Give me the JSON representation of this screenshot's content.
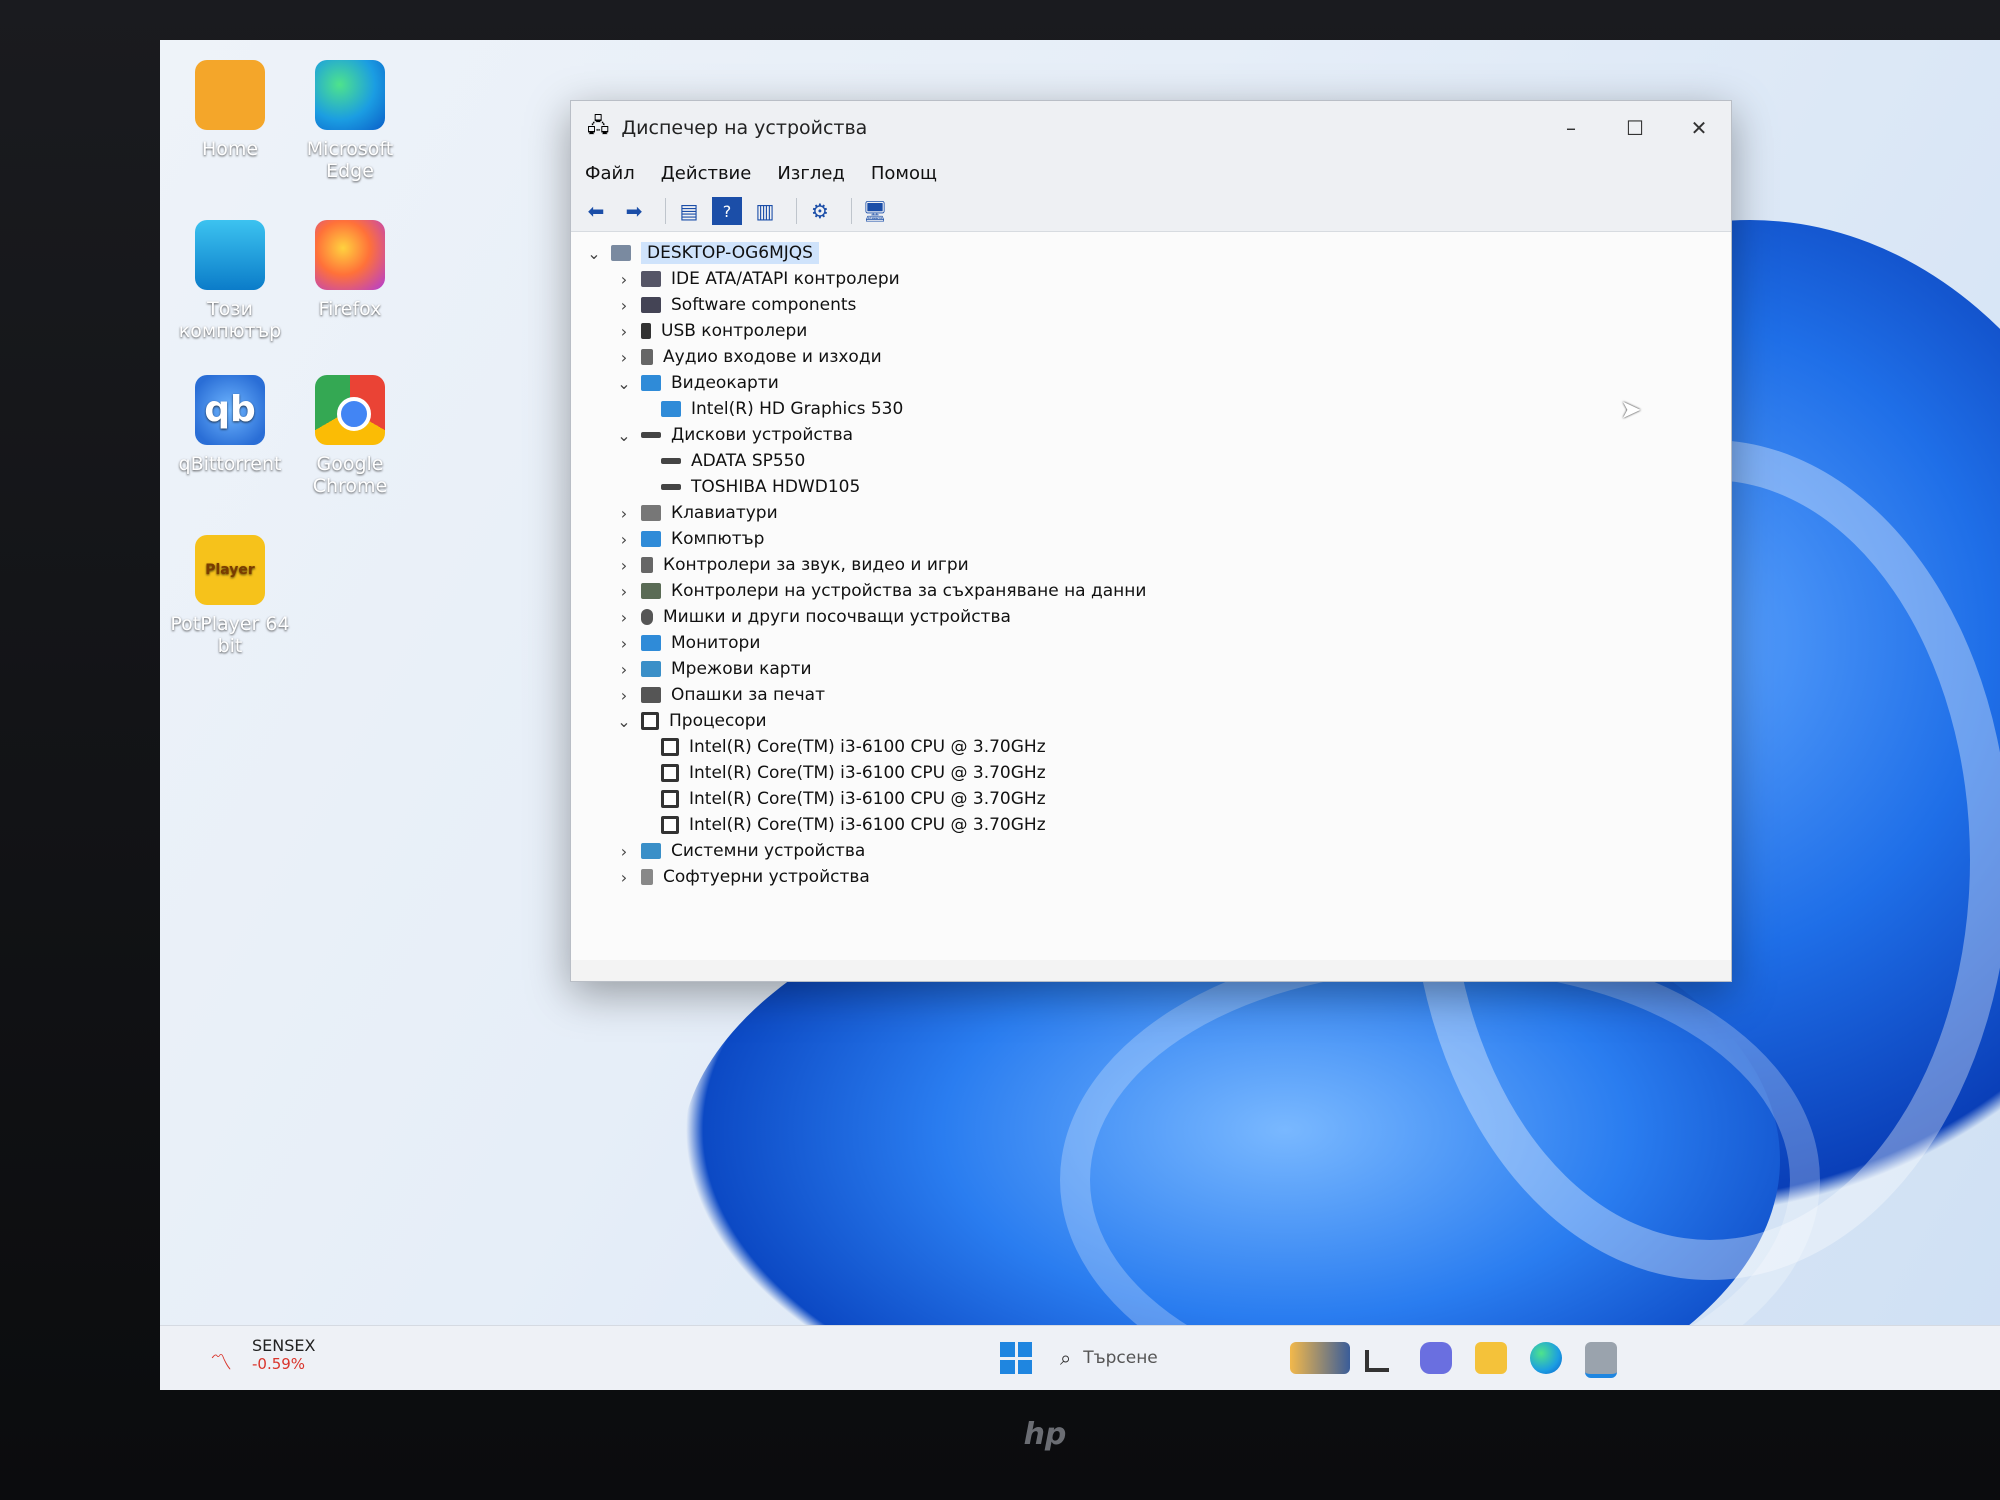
{
  "desktop": {
    "icons": [
      {
        "label": "Home"
      },
      {
        "label": "Microsoft Edge"
      },
      {
        "label": "Този компютър"
      },
      {
        "label": "Firefox"
      },
      {
        "label": "qBittorrent"
      },
      {
        "label": "Google Chrome"
      },
      {
        "label": "PotPlayer 64 bit"
      }
    ]
  },
  "window": {
    "title": "Диспечер на устройства",
    "controls": {
      "minimize": "–",
      "maximize": "☐",
      "close": "✕"
    },
    "menu": [
      "Файл",
      "Действие",
      "Изглед",
      "Помощ"
    ],
    "toolbar_icons": [
      "back-icon",
      "forward-icon",
      "properties-icon",
      "help-icon",
      "view-icon",
      "scan-icon",
      "monitor-icon"
    ],
    "tree": {
      "root": "DESKTOP-OG6MJQS",
      "nodes": [
        {
          "label": "IDE ATA/ATAPI контролери",
          "expanded": false
        },
        {
          "label": "Software components",
          "expanded": false
        },
        {
          "label": "USB контролери",
          "expanded": false
        },
        {
          "label": "Аудио входове и изходи",
          "expanded": false
        },
        {
          "label": "Видеокарти",
          "expanded": true,
          "children": [
            "Intel(R) HD Graphics 530"
          ]
        },
        {
          "label": "Дискови устройства",
          "expanded": true,
          "children": [
            "ADATA SP550",
            "TOSHIBA HDWD105"
          ]
        },
        {
          "label": "Клавиатури",
          "expanded": false
        },
        {
          "label": "Компютър",
          "expanded": false
        },
        {
          "label": "Контролери за звук, видео и игри",
          "expanded": false
        },
        {
          "label": "Контролери на устройства за съхраняване на данни",
          "expanded": false
        },
        {
          "label": "Мишки и други посочващи устройства",
          "expanded": false
        },
        {
          "label": "Монитори",
          "expanded": false
        },
        {
          "label": "Мрежови карти",
          "expanded": false
        },
        {
          "label": "Опашки за печат",
          "expanded": false
        },
        {
          "label": "Процесори",
          "expanded": true,
          "children": [
            "Intel(R) Core(TM) i3-6100 CPU @ 3.70GHz",
            "Intel(R) Core(TM) i3-6100 CPU @ 3.70GHz",
            "Intel(R) Core(TM) i3-6100 CPU @ 3.70GHz",
            "Intel(R) Core(TM) i3-6100 CPU @ 3.70GHz"
          ]
        },
        {
          "label": "Системни устройства",
          "expanded": false
        },
        {
          "label": "Софтуерни устройства",
          "expanded": false
        }
      ]
    }
  },
  "taskbar": {
    "ticker_name": "SENSEX",
    "ticker_change": "-0.59%",
    "search_placeholder": "Търсене",
    "icons": [
      "weather-icon",
      "task-view-icon",
      "chat-icon",
      "file-explorer-icon",
      "edge-icon",
      "device-manager-icon"
    ]
  },
  "bezel": {
    "brand": "hp"
  },
  "colors": {
    "accent": "#1f86e0",
    "selection": "#cfe3fb",
    "ticker_down": "#d9342b"
  }
}
